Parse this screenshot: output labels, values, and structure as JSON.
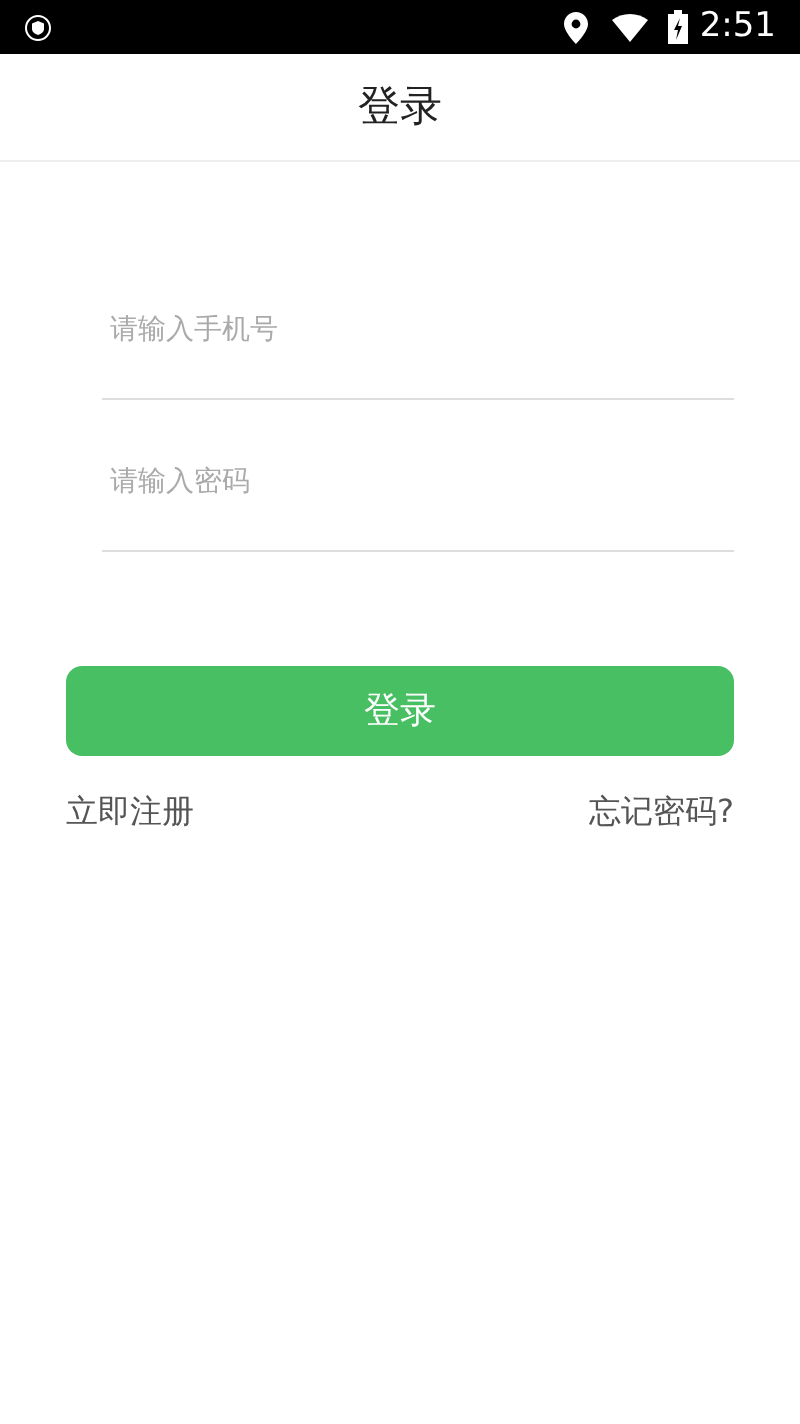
{
  "status_bar": {
    "time": "2:51"
  },
  "header": {
    "title": "登录"
  },
  "fields": [
    {
      "placeholder": "请输入手机号"
    },
    {
      "placeholder": "请输入密码"
    }
  ],
  "login_button": "登录",
  "links": {
    "register": "立即注册",
    "forgot": "忘记密码?"
  }
}
